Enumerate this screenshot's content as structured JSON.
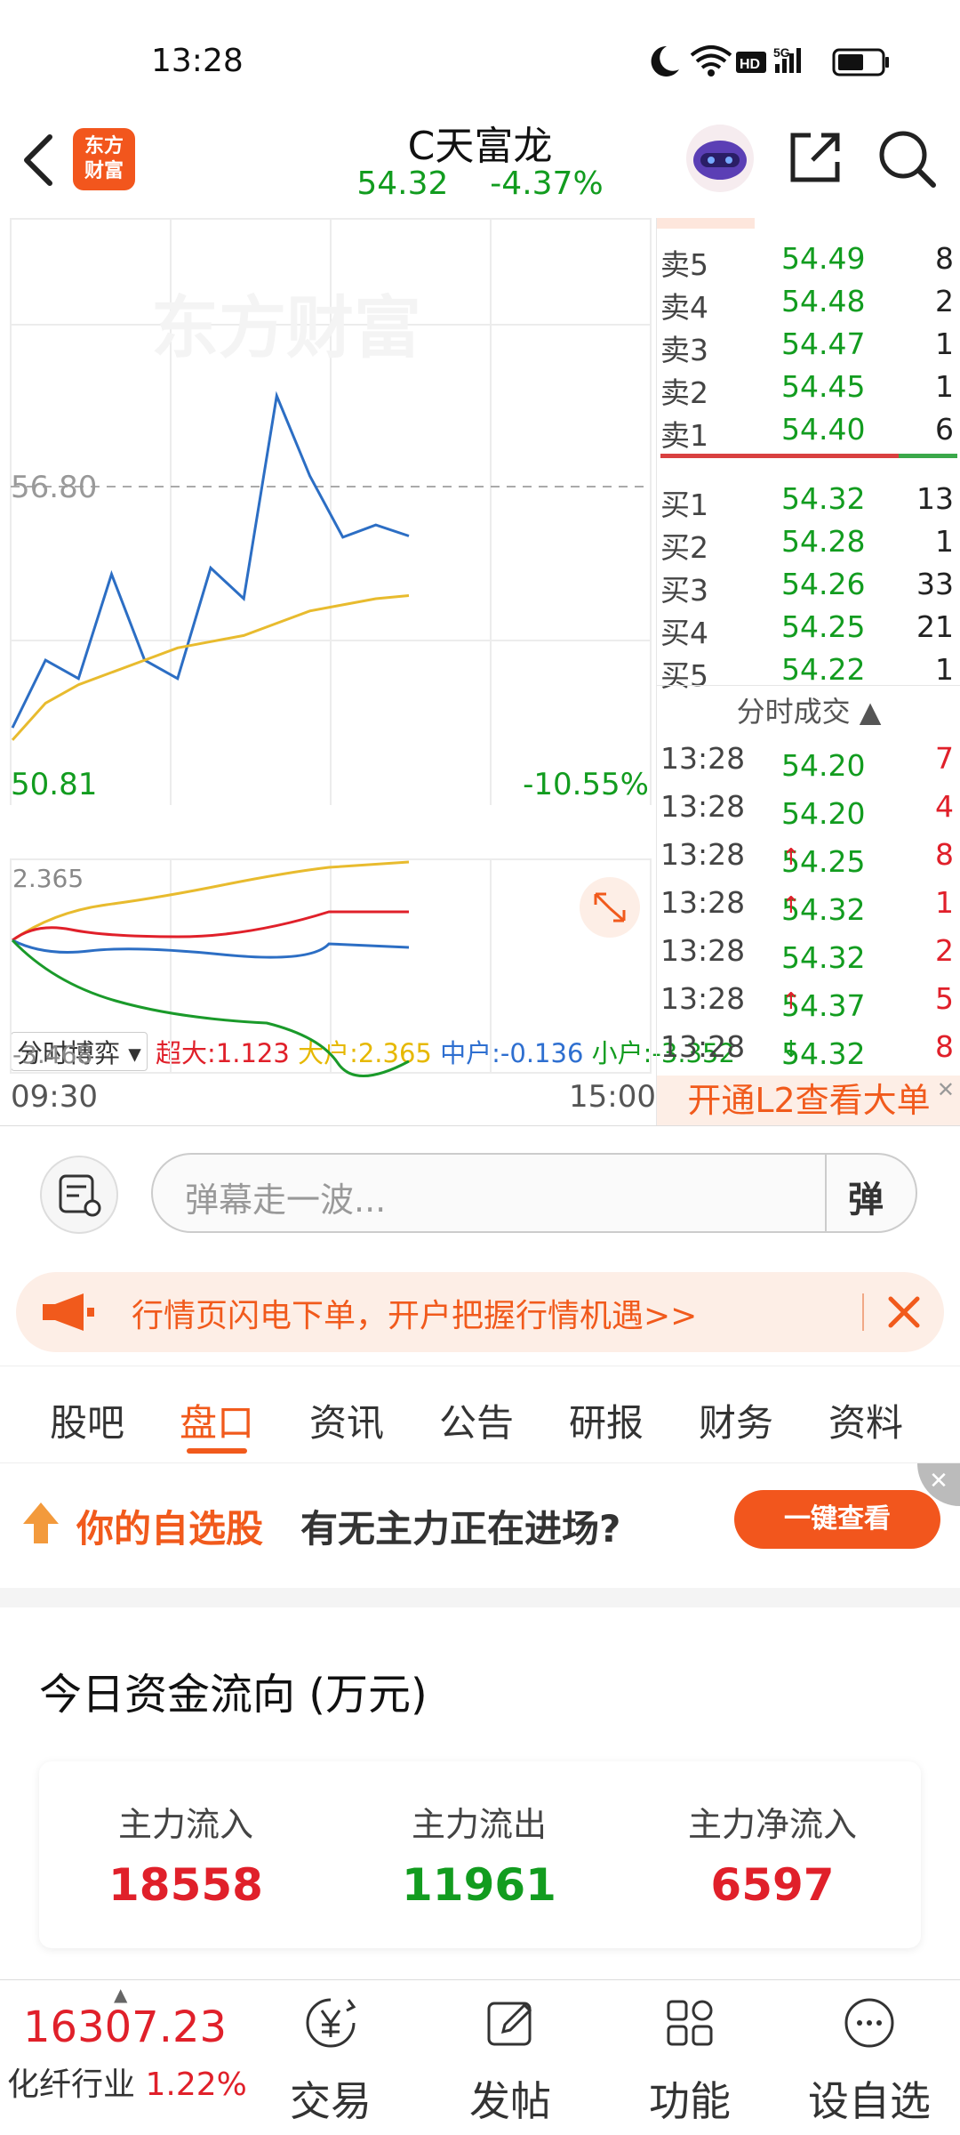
{
  "status_bar": {
    "time": "13:28"
  },
  "header": {
    "stock_name": "C天富龙",
    "price": "54.32",
    "change_pct": "-4.37%",
    "logo_text_top": "东方",
    "logo_text_bottom": "财富"
  },
  "chart": {
    "prev_close_label": "56.80",
    "watermark": "东方财富",
    "low_label": "50.81",
    "low_pct": "-10.55%",
    "flow_selector": "分时博弈",
    "flow_legend": [
      {
        "name": "超大",
        "value": "1.123",
        "color": "#e0202a"
      },
      {
        "name": "大户",
        "value": "2.365",
        "color": "#e6b800"
      },
      {
        "name": "中户",
        "value": "-0.136",
        "color": "#2e6fd0"
      },
      {
        "name": "小户",
        "value": "-3.352",
        "color": "#129c1f"
      }
    ],
    "flow_max": "2.365",
    "flow_min": "-3.468",
    "time_start": "09:30",
    "time_end": "15:00"
  },
  "chart_data": {
    "type": "line",
    "x": [
      "09:30",
      "15:00"
    ],
    "series": [
      {
        "values": [
          51.2,
          52.3,
          52.0,
          53.7,
          52.3,
          52.0,
          53.8,
          53.3,
          56.6,
          55.3,
          54.3,
          54.5,
          54.32
        ]
      },
      {
        "values": [
          51.0,
          51.6,
          51.9,
          52.1,
          52.3,
          52.5,
          52.6,
          52.7,
          52.9,
          53.1,
          53.2,
          53.3,
          53.35
        ]
      }
    ],
    "ylim": [
      50.81,
      56.8
    ]
  },
  "orderbook": {
    "asks": [
      {
        "label": "卖5",
        "price": "54.49",
        "vol": "8"
      },
      {
        "label": "卖4",
        "price": "54.48",
        "vol": "2"
      },
      {
        "label": "卖3",
        "price": "54.47",
        "vol": "1"
      },
      {
        "label": "卖2",
        "price": "54.45",
        "vol": "1"
      },
      {
        "label": "卖1",
        "price": "54.40",
        "vol": "6"
      }
    ],
    "bids": [
      {
        "label": "买1",
        "price": "54.32",
        "vol": "13"
      },
      {
        "label": "买2",
        "price": "54.28",
        "vol": "1"
      },
      {
        "label": "买3",
        "price": "54.26",
        "vol": "33"
      },
      {
        "label": "买4",
        "price": "54.25",
        "vol": "21"
      },
      {
        "label": "买5",
        "price": "54.22",
        "vol": "1"
      }
    ],
    "trades_title": "分时成交",
    "trades": [
      {
        "time": "13:28",
        "price": "54.20",
        "arrow": "",
        "vol": "7",
        "vol_color": "#e0202a"
      },
      {
        "time": "13:28",
        "price": "54.20",
        "arrow": "",
        "vol": "4",
        "vol_color": "#129c1f"
      },
      {
        "time": "13:28",
        "price": "54.25",
        "arrow": "↑",
        "vol": "8",
        "vol_color": "#e0202a"
      },
      {
        "time": "13:28",
        "price": "54.32",
        "arrow": "↑",
        "vol": "1",
        "vol_color": "#e0202a"
      },
      {
        "time": "13:28",
        "price": "54.32",
        "arrow": "",
        "vol": "2",
        "vol_color": "#e0202a"
      },
      {
        "time": "13:28",
        "price": "54.37",
        "arrow": "↑",
        "vol": "5",
        "vol_color": "#e0202a"
      },
      {
        "time": "13:28",
        "price": "54.32",
        "arrow": "↓",
        "vol": "8",
        "vol_color": "#129c1f"
      }
    ],
    "l2_banner": "开通L2查看大单"
  },
  "danmu": {
    "placeholder": "弹幕走一波...",
    "button": "弹"
  },
  "promo": {
    "text": "行情页闪电下单，开户把握行情机遇>>"
  },
  "tabs": [
    "股吧",
    "盘口",
    "资讯",
    "公告",
    "研报",
    "财务",
    "资料"
  ],
  "watch_promo": {
    "highlight": "你的自选股",
    "text": "有无主力正在进场?",
    "button": "一键查看"
  },
  "fund_flow": {
    "title": "今日资金流向 (万元)",
    "items": [
      {
        "label": "主力流入",
        "value": "18558",
        "color": "#e0202a"
      },
      {
        "label": "主力流出",
        "value": "11961",
        "color": "#129c1f"
      },
      {
        "label": "主力净流入",
        "value": "6597",
        "color": "#e0202a"
      }
    ]
  },
  "bottom_nav": {
    "index_value": "16307.23",
    "index_name": "化纤行业",
    "index_change": "1.22%",
    "items": [
      "交易",
      "发帖",
      "功能",
      "设自选"
    ]
  }
}
